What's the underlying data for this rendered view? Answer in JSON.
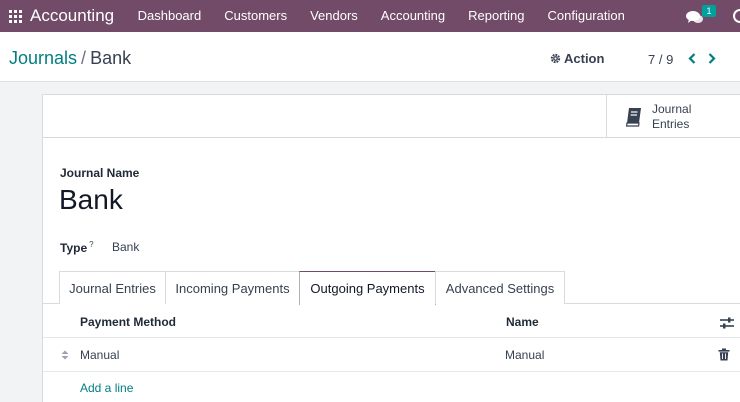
{
  "navbar": {
    "app_name": "Accounting",
    "menu": [
      "Dashboard",
      "Customers",
      "Vendors",
      "Accounting",
      "Reporting",
      "Configuration"
    ],
    "chat_badge": "1",
    "color": "#714b67"
  },
  "control_panel": {
    "breadcrumb_parent": "Journals",
    "breadcrumb_separator": "/",
    "breadcrumb_current": "Bank",
    "action_label": "Action",
    "pager_value": "7 / 9"
  },
  "form": {
    "stat_button": {
      "line1": "Journal",
      "line2": "Entries",
      "icon": "book-icon"
    },
    "journal_name_label": "Journal Name",
    "journal_name": "Bank",
    "type_label": "Type",
    "type_help": "?",
    "type_value": "Bank",
    "tabs": [
      {
        "label": "Journal Entries",
        "active": false
      },
      {
        "label": "Incoming Payments",
        "active": false
      },
      {
        "label": "Outgoing Payments",
        "active": true
      },
      {
        "label": "Advanced Settings",
        "active": false
      }
    ],
    "table": {
      "headers": [
        "Payment Method",
        "Name"
      ],
      "rows": [
        {
          "payment_method": "Manual",
          "name": "Manual"
        }
      ],
      "add_line": "Add a line"
    }
  },
  "accent_color": "#017e84"
}
